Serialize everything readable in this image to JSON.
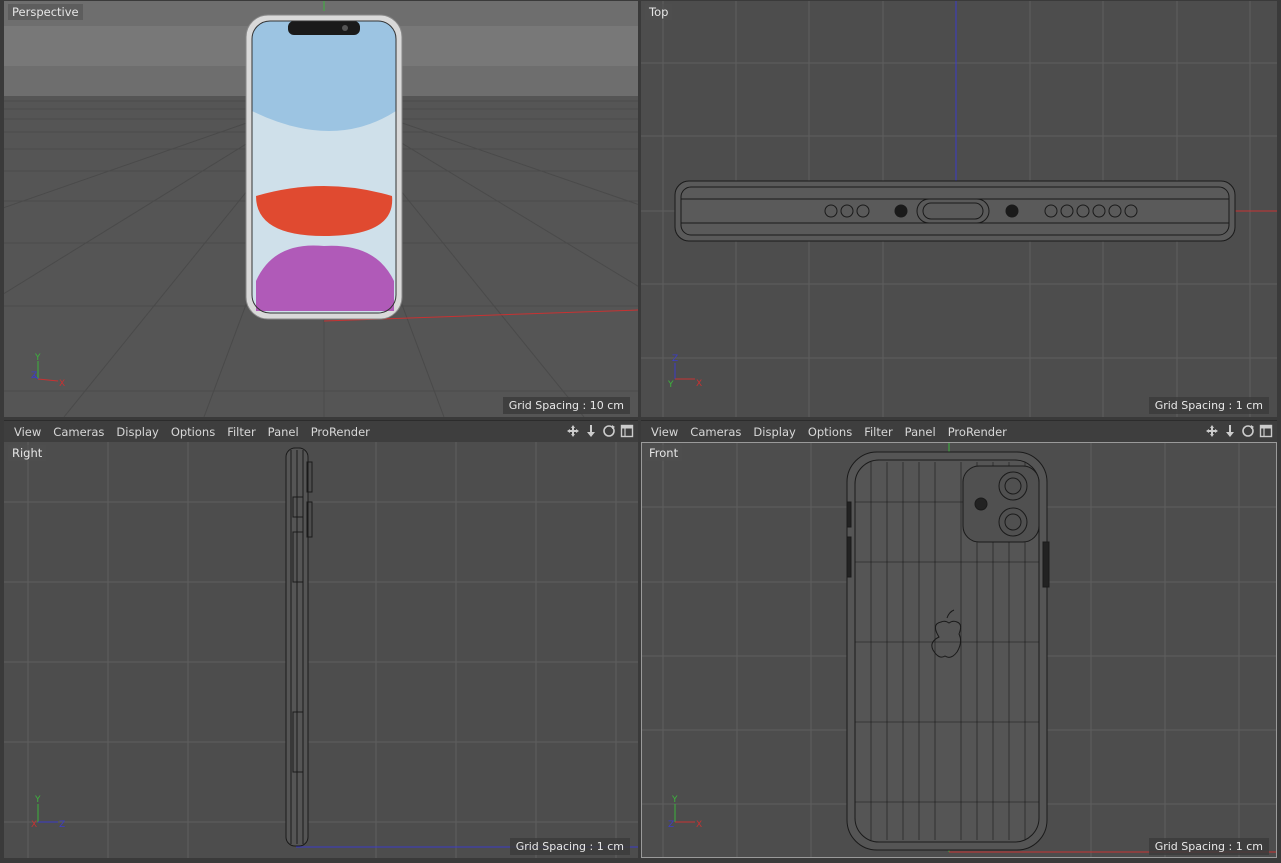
{
  "viewports": {
    "perspective": {
      "label": "Perspective",
      "grid_spacing": "Grid Spacing : 10 cm",
      "axes": [
        "Y",
        "Z",
        "X"
      ]
    },
    "top": {
      "label": "Top",
      "grid_spacing": "Grid Spacing : 1 cm",
      "axes": [
        "Z",
        "Y",
        "X"
      ]
    },
    "right": {
      "label": "Right",
      "grid_spacing": "Grid Spacing : 1 cm",
      "axes": [
        "Y",
        "X",
        "Z"
      ]
    },
    "front": {
      "label": "Front",
      "grid_spacing": "Grid Spacing : 1 cm",
      "axes": [
        "Y",
        "Z",
        "X"
      ]
    }
  },
  "menubar_left": [
    "View",
    "Cameras",
    "Display",
    "Options",
    "Filter",
    "Panel",
    "ProRender"
  ],
  "menubar_right": [
    "View",
    "Cameras",
    "Display",
    "Options",
    "Filter",
    "Panel",
    "ProRender"
  ],
  "nav_icons": [
    "move-view-icon",
    "dolly-view-icon",
    "rotate-view-icon",
    "toggle-layout-icon"
  ],
  "colors": {
    "viewport_bg": "#4d4d4d",
    "grid": "#5c5c5c",
    "axis_x": "#c83232",
    "axis_y": "#3cb43c",
    "axis_z": "#3c3cc8",
    "wire": "#1a1a1a"
  }
}
